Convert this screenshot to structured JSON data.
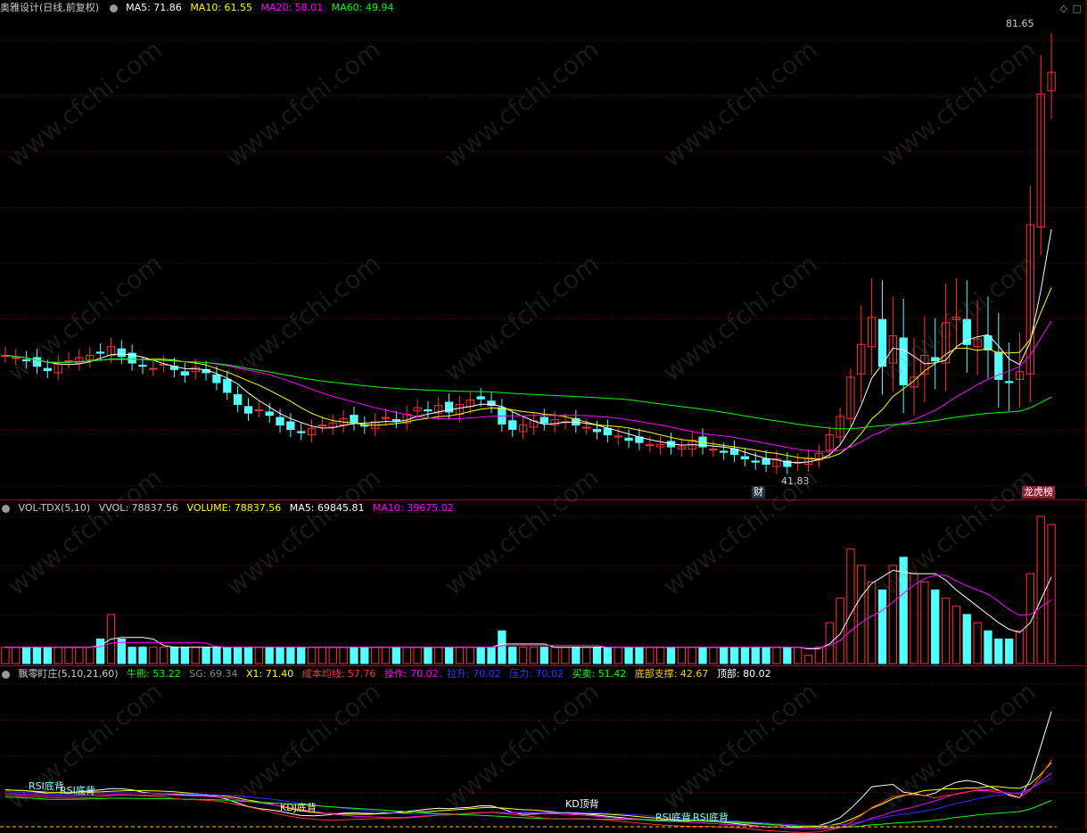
{
  "header": {
    "title": "奥雅设计(日线,前复权)",
    "ma": [
      {
        "label": "MA5: 71.86",
        "color": "#ffffff"
      },
      {
        "label": "MA10: 61.55",
        "color": "#ffff00"
      },
      {
        "label": "MA20: 58.01",
        "color": "#ff00ff"
      },
      {
        "label": "MA60: 49.94",
        "color": "#00ff00"
      }
    ]
  },
  "price_panel": {
    "high_label": "81.65",
    "low_label": "41.83",
    "tag_left": "财",
    "tag_right": "龙虎榜"
  },
  "vol_header": {
    "name": "VOL-TDX(5,10)",
    "items": [
      {
        "label": "VVOL: 78837.56",
        "color": "#cccccc"
      },
      {
        "label": "VOLUME: 78837.56",
        "color": "#ffff00"
      },
      {
        "label": "MA5: 69845.81",
        "color": "#ffffff"
      },
      {
        "label": "MA10: 39675.02",
        "color": "#ff00ff"
      }
    ]
  },
  "ind_header": {
    "name": "飘零盯庄(5,10,21,60)",
    "items": [
      {
        "label": "牛熊: 53.22",
        "color": "#00ff00"
      },
      {
        "label": "SG: 69.34",
        "color": "#888888"
      },
      {
        "label": "X1: 71.40",
        "color": "#ffff00"
      },
      {
        "label": "成本均线: 57.76",
        "color": "#ff3030"
      },
      {
        "label": "操作: 70.02",
        "color": "#ff00ff"
      },
      {
        "label": "拉升: 70.02",
        "color": "#3030ff"
      },
      {
        "label": "压力: 70.02",
        "color": "#3030ff"
      },
      {
        "label": "买卖: 51.42",
        "color": "#00ff00"
      },
      {
        "label": "底部支撑: 42.67",
        "color": "#ffcc00"
      },
      {
        "label": "顶部: 80.02",
        "color": "#ffffff"
      }
    ],
    "tags": [
      "RSI底背",
      "RSI底背",
      "KDJ底背",
      "KD顶背",
      "RSI底背",
      "RSI底背"
    ]
  },
  "watermark": "www.cfchi.com",
  "chart_data": {
    "type": "line",
    "title": "奥雅设计(日线,前复权)",
    "price_range": [
      40,
      83
    ],
    "bars_count": 100,
    "close": [
      52.0,
      51.8,
      51.5,
      51.0,
      50.6,
      51.2,
      51.5,
      51.8,
      52.0,
      52.2,
      52.8,
      51.9,
      51.3,
      51.0,
      50.8,
      51.2,
      50.7,
      50.2,
      50.9,
      50.4,
      49.5,
      48.6,
      47.5,
      46.7,
      47.0,
      46.5,
      45.6,
      45.2,
      44.9,
      45.3,
      45.6,
      45.8,
      46.2,
      45.8,
      45.5,
      45.9,
      46.3,
      46.0,
      46.6,
      47.2,
      46.9,
      47.4,
      46.8,
      47.5,
      47.9,
      48.0,
      47.4,
      45.7,
      45.2,
      45.6,
      46.0,
      45.8,
      46.1,
      45.9,
      45.6,
      45.4,
      45.0,
      44.7,
      44.6,
      44.2,
      44.0,
      43.8,
      43.8,
      43.6,
      43.6,
      44.2,
      43.6,
      43.4,
      43.1,
      42.9,
      42.5,
      42.2,
      42.0,
      42.5,
      41.8,
      42.2,
      42.6,
      43.0,
      44.7,
      46.4,
      50.0,
      53.0,
      55.5,
      51.0,
      53.8,
      49.3,
      50.0,
      52.0,
      51.5,
      55.0,
      55.5,
      53.0,
      53.5,
      52.5,
      49.8,
      49.5,
      50.5,
      64.0,
      76.0,
      78.0
    ],
    "series": [
      {
        "name": "MA5",
        "color": "#ffffff"
      },
      {
        "name": "MA10",
        "color": "#ffff00"
      },
      {
        "name": "MA20",
        "color": "#ff00ff"
      },
      {
        "name": "MA60",
        "color": "#00ff00"
      }
    ],
    "volume": [
      2,
      2,
      2,
      2,
      2,
      2,
      2,
      2,
      2,
      3,
      6,
      3,
      2,
      2,
      2,
      2,
      2,
      2,
      2,
      2,
      2,
      2,
      2,
      2,
      2,
      2,
      2,
      2,
      2,
      2,
      2,
      2,
      2,
      2,
      2,
      2,
      2,
      2,
      2,
      2,
      2,
      2,
      2,
      2,
      2,
      2,
      2,
      4,
      2,
      2,
      2,
      2,
      2,
      2,
      2,
      2,
      2,
      2,
      2,
      2,
      2,
      2,
      2,
      2,
      2,
      2,
      2,
      2,
      2,
      2,
      2,
      2,
      2,
      2,
      2,
      2,
      1,
      2,
      5,
      8,
      14,
      12,
      10,
      9,
      12,
      13,
      11,
      10,
      9,
      8,
      7,
      6,
      5,
      4,
      3,
      3,
      4,
      11,
      18,
      17
    ],
    "volume_range": [
      0,
      18
    ]
  }
}
